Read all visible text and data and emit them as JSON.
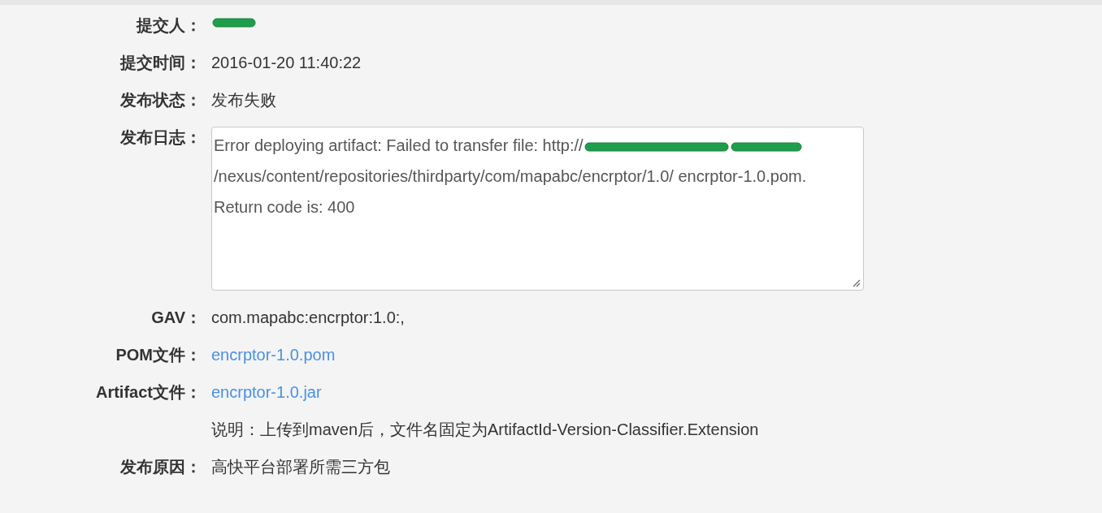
{
  "fields": [
    {
      "label": "提交人：",
      "kind": "redacted"
    },
    {
      "label": "提交时间：",
      "kind": "text",
      "value": "2016-01-20 11:40:22"
    },
    {
      "label": "发布状态：",
      "kind": "text",
      "value": "发布失败"
    },
    {
      "label": "发布日志：",
      "kind": "log",
      "segments": [
        {
          "kind": "text",
          "text": "Error deploying artifact: Failed to transfer file: http://"
        },
        {
          "kind": "redacted"
        },
        {
          "kind": "redacted"
        },
        {
          "kind": "text",
          "text": "/nexus/content/repositories/thirdparty/com/mapabc/encrptor/1.0/ encrptor-1.0.pom. Return code is: 400"
        }
      ]
    },
    {
      "label": "GAV：",
      "kind": "text",
      "value": "com.mapabc:encrptor:1.0:,"
    },
    {
      "label": "POM文件：",
      "kind": "link",
      "value": "encrptor-1.0.pom"
    },
    {
      "label": "Artifact文件：",
      "kind": "link",
      "value": "encrptor-1.0.jar"
    },
    {
      "kind": "text",
      "value": "说明：上传到maven后，文件名固定为ArtifactId-Version-Classifier.Extension"
    },
    {
      "label": "发布原因：",
      "kind": "text",
      "value": "高快平台部署所需三方包"
    }
  ]
}
